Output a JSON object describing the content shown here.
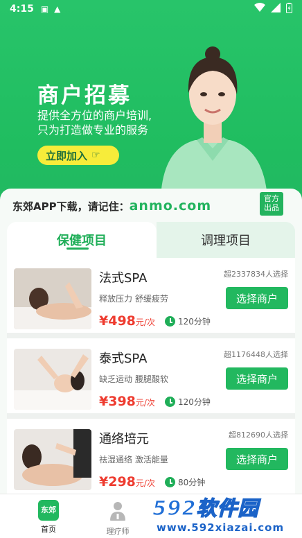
{
  "status": {
    "time": "4:15"
  },
  "hero": {
    "title": "商户招募",
    "subtitle_line1": "提供全方位的商户培训,",
    "subtitle_line2": "只为打造做专业的服务",
    "join_label": "立即加入"
  },
  "download": {
    "prefix": "东郊APP下载，请记住：",
    "domain": "anmo.com",
    "badge_line1": "官方",
    "badge_line2": "出品"
  },
  "tabs": [
    {
      "label": "保健项目",
      "active": true
    },
    {
      "label": "调理项目",
      "active": false
    }
  ],
  "services": [
    {
      "name": "法式SPA",
      "count": "超2337834人选择",
      "tags": "释放压力 舒缓疲劳",
      "price": "¥498",
      "unit": "元/次",
      "duration": "120分钟",
      "button": "选择商户"
    },
    {
      "name": "泰式SPA",
      "count": "超1176448人选择",
      "tags": "缺乏运动 腰腿酸软",
      "price": "¥398",
      "unit": "元/次",
      "duration": "120分钟",
      "button": "选择商户"
    },
    {
      "name": "通络培元",
      "count": "超812690人选择",
      "tags": "祛湿通络 激活能量",
      "price": "¥298",
      "unit": "元/次",
      "duration": "80分钟",
      "button": "选择商户"
    }
  ],
  "nav": {
    "home_icon_text": "东郊",
    "home_label": "首页",
    "therapist_label": "理疗师"
  },
  "watermark": {
    "brand_num": "592",
    "brand_text": "软件园",
    "url": "www.592xiazai.com"
  },
  "colors": {
    "primary": "#22b85f",
    "price": "#ee3b2f",
    "join": "#f7ec3a"
  }
}
